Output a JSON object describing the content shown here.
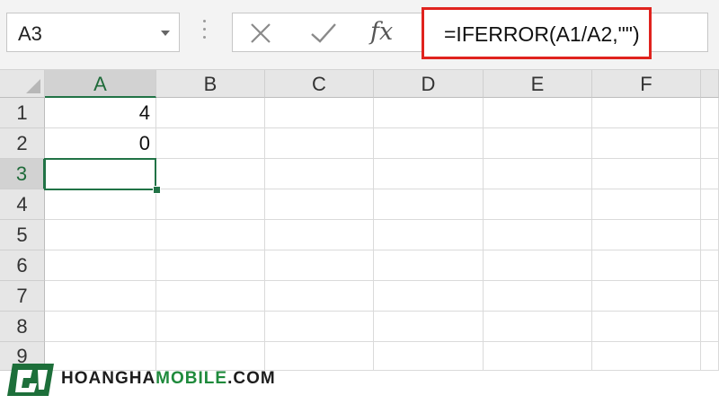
{
  "formula_bar": {
    "name_box": "A3",
    "fx_label": "fx",
    "formula": "=IFERROR(A1/A2,\"\")"
  },
  "sheet": {
    "columns": [
      "A",
      "B",
      "C",
      "D",
      "E",
      "F"
    ],
    "rows": [
      "1",
      "2",
      "3",
      "4",
      "5",
      "6",
      "7",
      "8",
      "9"
    ],
    "cells": {
      "A1": "4",
      "A2": "0"
    },
    "active_cell": "A3"
  },
  "watermark": {
    "brand_a": "HOANGHA",
    "brand_b": "MOBILE",
    "brand_c": ".COM"
  },
  "colors": {
    "selection": "#217346",
    "highlight_border": "#e0231e",
    "brand_green": "#1f8a3c"
  }
}
